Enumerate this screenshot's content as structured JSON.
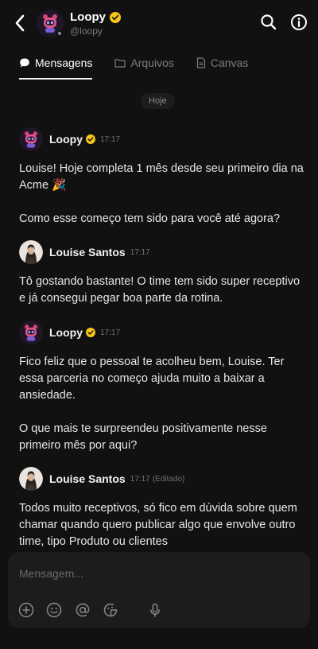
{
  "header": {
    "name": "Loopy",
    "handle": "@loopy"
  },
  "tabs": [
    {
      "label": "Mensagens",
      "icon": "chat-bubble-icon",
      "active": true
    },
    {
      "label": "Arquivos",
      "icon": "folder-icon",
      "active": false
    },
    {
      "label": "Canvas",
      "icon": "document-icon",
      "active": false
    }
  ],
  "date_divider": "Hoje",
  "messages": [
    {
      "author": "Loopy",
      "time": "17:17",
      "verified": true,
      "edited": "",
      "text": "Louise! Hoje completa 1 mês desde seu primeiro dia na Acme 🎉\n\nComo esse começo tem sido para você até agora?"
    },
    {
      "author": "Louise Santos",
      "time": "17:17",
      "verified": false,
      "edited": "",
      "text": "Tô gostando bastante! O time tem sido super receptivo e já consegui pegar boa parte da rotina."
    },
    {
      "author": "Loopy",
      "time": "17:17",
      "verified": true,
      "edited": "",
      "text": "Fico feliz que o pessoal te acolheu bem, Louise. Ter essa parceria no começo ajuda muito a baixar a ansiedade.\n\nO que mais te surpreendeu positivamente nesse primeiro mês por aqui?"
    },
    {
      "author": "Louise Santos",
      "time": "17:17",
      "verified": false,
      "edited": "(Editado)",
      "text": "Todos muito receptivos, só fico em dúvida sobre quem chamar quando quero publicar algo que envolve outro time, tipo Produto ou clientes"
    }
  ],
  "composer": {
    "placeholder": "Mensagem...",
    "icons": [
      "plus-icon",
      "emoji-icon",
      "mention-icon",
      "sticker-icon",
      "microphone-icon"
    ]
  },
  "colors": {
    "background": "#111111",
    "verified_badge": "#f5c518",
    "composer": "#1c1c1c"
  }
}
